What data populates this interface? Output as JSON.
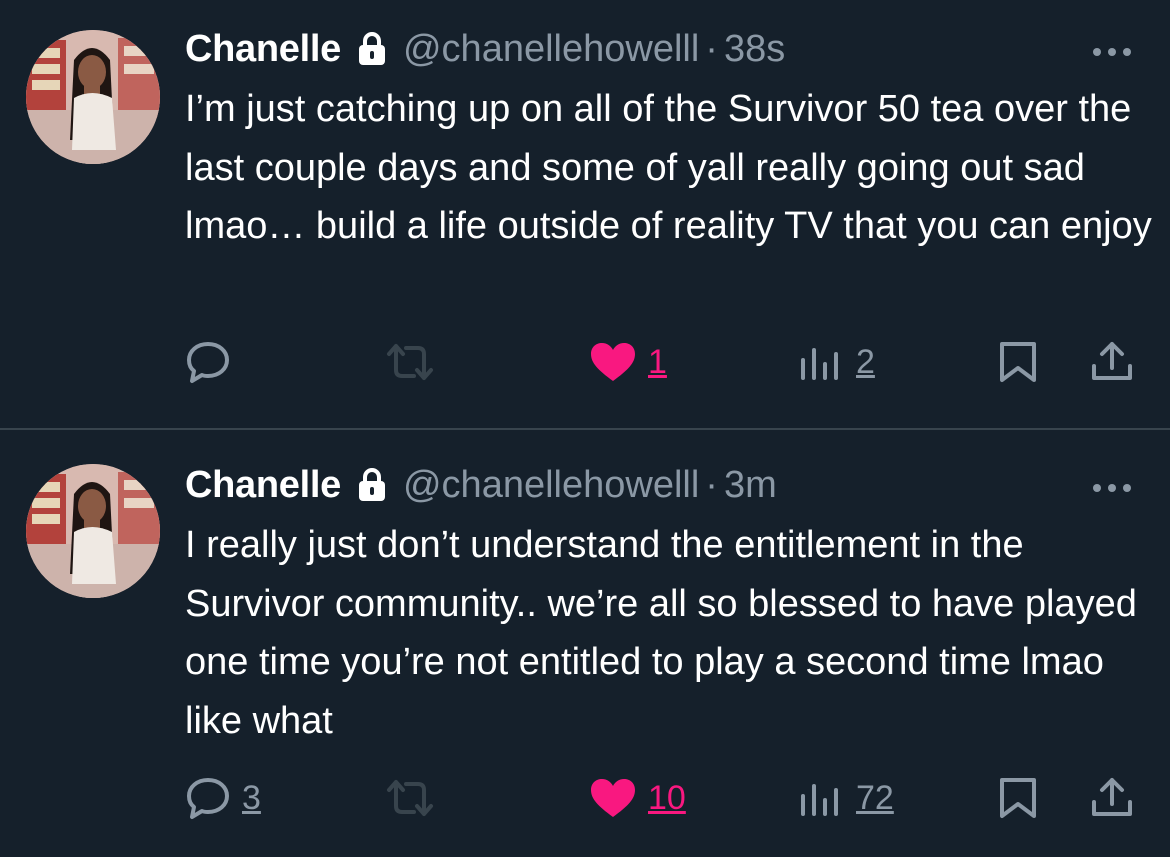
{
  "colors": {
    "background": "#15202b",
    "text": "#ffffff",
    "muted": "#8b98a5",
    "like": "#f91880",
    "divider": "#38444d"
  },
  "tweets": [
    {
      "display_name": "Chanelle",
      "handle": "@chanellehowelll",
      "separator": "·",
      "time": "38s",
      "text": "I’m just catching up on all of the Survivor 50 tea over the last couple days and some of yall really going out sad lmao… build a life outside of reality TV that you can enjoy",
      "reply_count": "",
      "like_count": "1",
      "view_count": "2",
      "liked": true,
      "icons": [
        "lock-icon",
        "more-icon",
        "reply-icon",
        "retweet-icon",
        "heart-icon",
        "views-icon",
        "bookmark-icon",
        "share-icon"
      ]
    },
    {
      "display_name": "Chanelle",
      "handle": "@chanellehowelll",
      "separator": "·",
      "time": "3m",
      "text": "I really just don’t understand the entitlement in the Survivor community.. we’re all so blessed to have played one time you’re not entitled to play a second time lmao like what",
      "reply_count": "3",
      "like_count": "10",
      "view_count": "72",
      "liked": true,
      "icons": [
        "lock-icon",
        "more-icon",
        "reply-icon",
        "retweet-icon",
        "heart-icon",
        "views-icon",
        "bookmark-icon",
        "share-icon"
      ]
    }
  ]
}
